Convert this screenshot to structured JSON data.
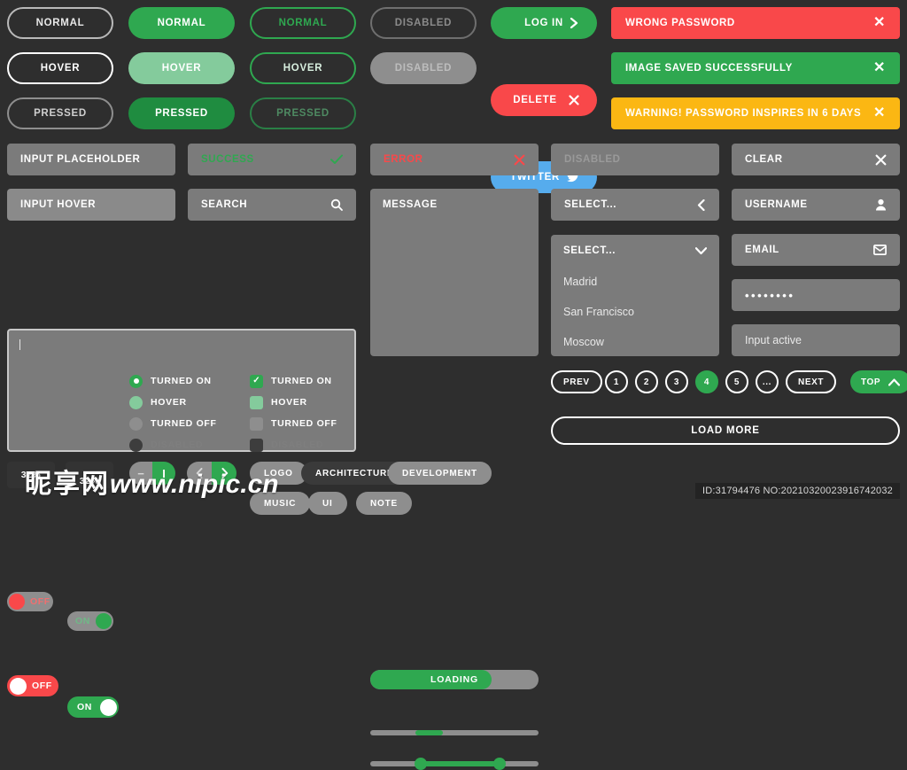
{
  "buttons": {
    "outline": [
      {
        "label": "NORMAL",
        "state": "normal"
      },
      {
        "label": "HOVER",
        "state": "hover"
      },
      {
        "label": "PRESSED",
        "state": "pressed"
      }
    ],
    "solid": [
      {
        "label": "NORMAL",
        "state": "normal"
      },
      {
        "label": "HOVER",
        "state": "hover"
      },
      {
        "label": "PRESSED",
        "state": "pressed"
      }
    ],
    "green_outline": [
      {
        "label": "NORMAL",
        "state": "normal"
      },
      {
        "label": "HOVER",
        "state": "hover"
      },
      {
        "label": "PRESSED",
        "state": "pressed"
      }
    ],
    "disabled": [
      {
        "label": "DISABLED",
        "state": "outline"
      },
      {
        "label": "DISABLED",
        "state": "solid"
      }
    ],
    "action": [
      {
        "label": "LOG IN",
        "icon": "chevron-right-icon",
        "color": "#2fa850"
      },
      {
        "label": "DELETE",
        "icon": "close-icon",
        "color": "#f9484a"
      },
      {
        "label": "TWITTER",
        "icon": "twitter-icon",
        "color": "#56aced"
      }
    ]
  },
  "alerts": [
    {
      "message": "WRONG PASSWORD",
      "type": "error",
      "color": "#f9484a",
      "close": "✕"
    },
    {
      "message": "IMAGE SAVED SUCCESSFULLY",
      "type": "success",
      "color": "#2fa850",
      "close": "✕"
    },
    {
      "message": "WARNING! PASSWORD INSPIRES IN 6 DAYS",
      "type": "warning",
      "color": "#fbb713",
      "close": "✕"
    }
  ],
  "inputs": {
    "placeholder": {
      "label": "INPUT PLACEHOLDER"
    },
    "hover": {
      "label": "INPUT HOVER"
    },
    "success": {
      "label": "SUCCESS",
      "icon": "check-icon"
    },
    "search": {
      "label": "SEARCH",
      "icon": "search-icon"
    },
    "error": {
      "label": "ERROR",
      "icon": "close-icon"
    },
    "message": {
      "label": "MESSAGE"
    },
    "disabled": {
      "label": "DISABLED"
    },
    "clear": {
      "label": "CLEAR",
      "icon": "close-icon"
    },
    "username": {
      "label": "USERNAME",
      "icon": "user-icon"
    },
    "email": {
      "label": "EMAIL",
      "icon": "mail-icon"
    },
    "password": {
      "value": "••••••••"
    },
    "active": {
      "value": "Input active"
    },
    "textarea": {
      "value": ""
    }
  },
  "selects": {
    "collapsed": {
      "label": "SELECT...",
      "icon": "chevron-left-icon"
    },
    "expanded": {
      "label": "SELECT...",
      "icon": "chevron-down-icon",
      "options": [
        "Madrid",
        "San Francisco",
        "Moscow"
      ]
    }
  },
  "toggles": [
    {
      "label": "OFF",
      "state": "off-hover",
      "track": "#8e8e8e",
      "knob": "#f9484a"
    },
    {
      "label": "ON",
      "state": "on-hover",
      "track": "#8e8e8e",
      "knob": "#2fa850"
    },
    {
      "label": "OFF",
      "state": "off",
      "track": "#f9484a",
      "knob": "#ffffff"
    },
    {
      "label": "ON",
      "state": "on",
      "track": "#2fa850",
      "knob": "#ffffff"
    }
  ],
  "radios": [
    {
      "label": "TURNED ON",
      "state": "on"
    },
    {
      "label": "HOVER",
      "state": "hover"
    },
    {
      "label": "TURNED OFF",
      "state": "off"
    },
    {
      "label": "DISABLED",
      "state": "disabled"
    }
  ],
  "checkboxes": [
    {
      "label": "TURNED ON",
      "state": "on",
      "icon": "check-icon"
    },
    {
      "label": "HOVER",
      "state": "hover"
    },
    {
      "label": "TURNED OFF",
      "state": "off"
    },
    {
      "label": "DISABLED",
      "state": "disabled"
    }
  ],
  "progress": {
    "loading": {
      "label": "LOADING",
      "percent": 72
    },
    "bar": {
      "percent": 32,
      "start": 27,
      "end": 43
    },
    "range": {
      "low": 30,
      "high": 77
    },
    "boxes": [
      {
        "label": "32%"
      },
      {
        "label": "32%"
      }
    ]
  },
  "steppers": [
    {
      "left": "−",
      "right": "I",
      "name": "quantity-stepper"
    },
    {
      "left": "‹",
      "right": "›",
      "name": "arrow-stepper"
    }
  ],
  "pagination": {
    "prev": "PREV",
    "pages": [
      "1",
      "2",
      "3",
      "4",
      "5",
      "..."
    ],
    "active": "4",
    "next": "NEXT",
    "top": {
      "label": "TOP",
      "icon": "chevron-up-icon"
    },
    "load_more": "LOAD MORE"
  },
  "chips": [
    {
      "label": "LOGO",
      "state": "normal"
    },
    {
      "label": "ARCHITECTURE",
      "state": "dark"
    },
    {
      "label": "DEVELOPMENT",
      "state": "normal"
    },
    {
      "label": "MUSIC",
      "state": "normal"
    },
    {
      "label": "UI",
      "state": "normal"
    },
    {
      "label": "NOTE",
      "state": "normal"
    }
  ],
  "footer": {
    "id_text": "ID:31794476 NO:20210320023916742032",
    "watermark_cn": "昵享网",
    "watermark_url": "www.nipic.cn"
  }
}
